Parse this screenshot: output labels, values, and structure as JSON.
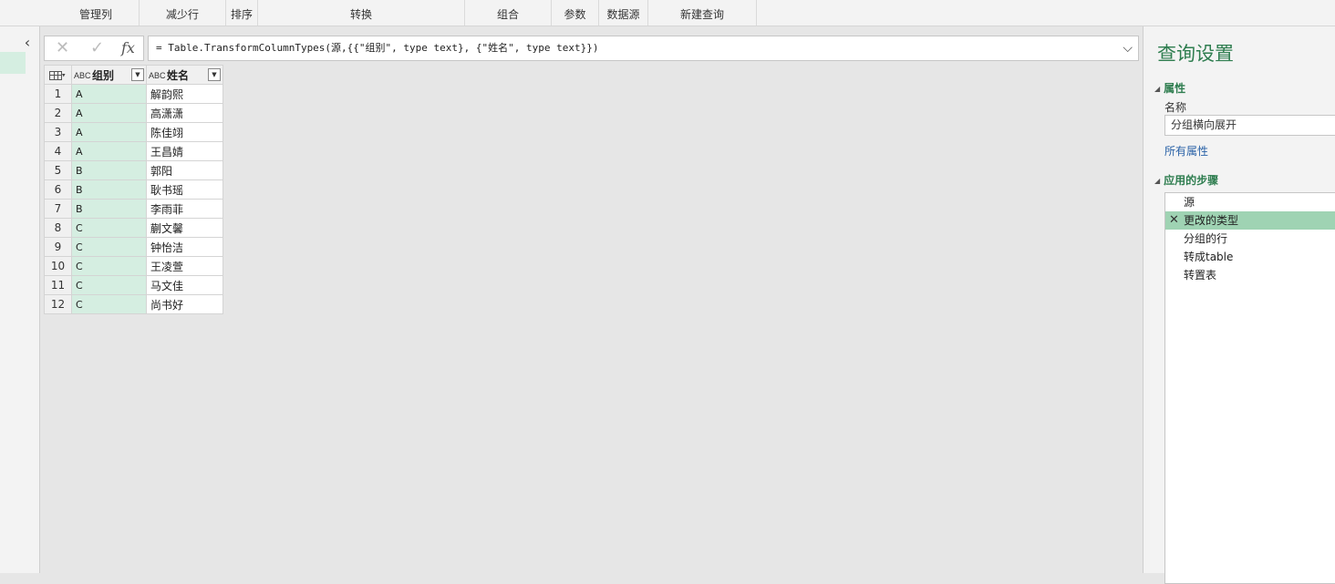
{
  "ribbon": {
    "groups": [
      "管理列",
      "减少行",
      "排序",
      "转换",
      "组合",
      "参数",
      "数据源",
      "新建查询"
    ]
  },
  "nav": {
    "collapse_glyph": "‹"
  },
  "formula_bar": {
    "cancel_glyph": "✕",
    "commit_glyph": "✓",
    "fx_label": "fx",
    "text": "= Table.TransformColumnTypes(源,{{\"组别\", type text}, {\"姓名\", type text}})",
    "expand_glyph": "⌵"
  },
  "grid": {
    "columns": [
      {
        "name": "组别",
        "type_icon": "ABC"
      },
      {
        "name": "姓名",
        "type_icon": "ABC"
      }
    ],
    "rows": [
      {
        "n": "1",
        "group": "A",
        "name": "解韵熙"
      },
      {
        "n": "2",
        "group": "A",
        "name": "高潇潇"
      },
      {
        "n": "3",
        "group": "A",
        "name": "陈佳翊"
      },
      {
        "n": "4",
        "group": "A",
        "name": "王昌婧"
      },
      {
        "n": "5",
        "group": "B",
        "name": "郭阳"
      },
      {
        "n": "6",
        "group": "B",
        "name": "耿书瑶"
      },
      {
        "n": "7",
        "group": "B",
        "name": "李雨菲"
      },
      {
        "n": "8",
        "group": "C",
        "name": "蒯文馨"
      },
      {
        "n": "9",
        "group": "C",
        "name": "钟怡洁"
      },
      {
        "n": "10",
        "group": "C",
        "name": "王凌萱"
      },
      {
        "n": "11",
        "group": "C",
        "name": "马文佳"
      },
      {
        "n": "12",
        "group": "C",
        "name": "尚书好"
      }
    ]
  },
  "query_settings": {
    "title": "查询设置",
    "properties_header": "属性",
    "name_label": "名称",
    "name_value": "分组横向展开",
    "all_properties_link": "所有属性",
    "applied_steps_header": "应用的步骤",
    "steps": [
      "源",
      "更改的类型",
      "分组的行",
      "转成table",
      "转置表"
    ],
    "selected_step_index": 1
  },
  "colors": {
    "accent_green": "#2e7d4f",
    "selected_column": "#d5eee1",
    "selected_step": "#9fd3b3",
    "link_blue": "#2a62a7"
  }
}
